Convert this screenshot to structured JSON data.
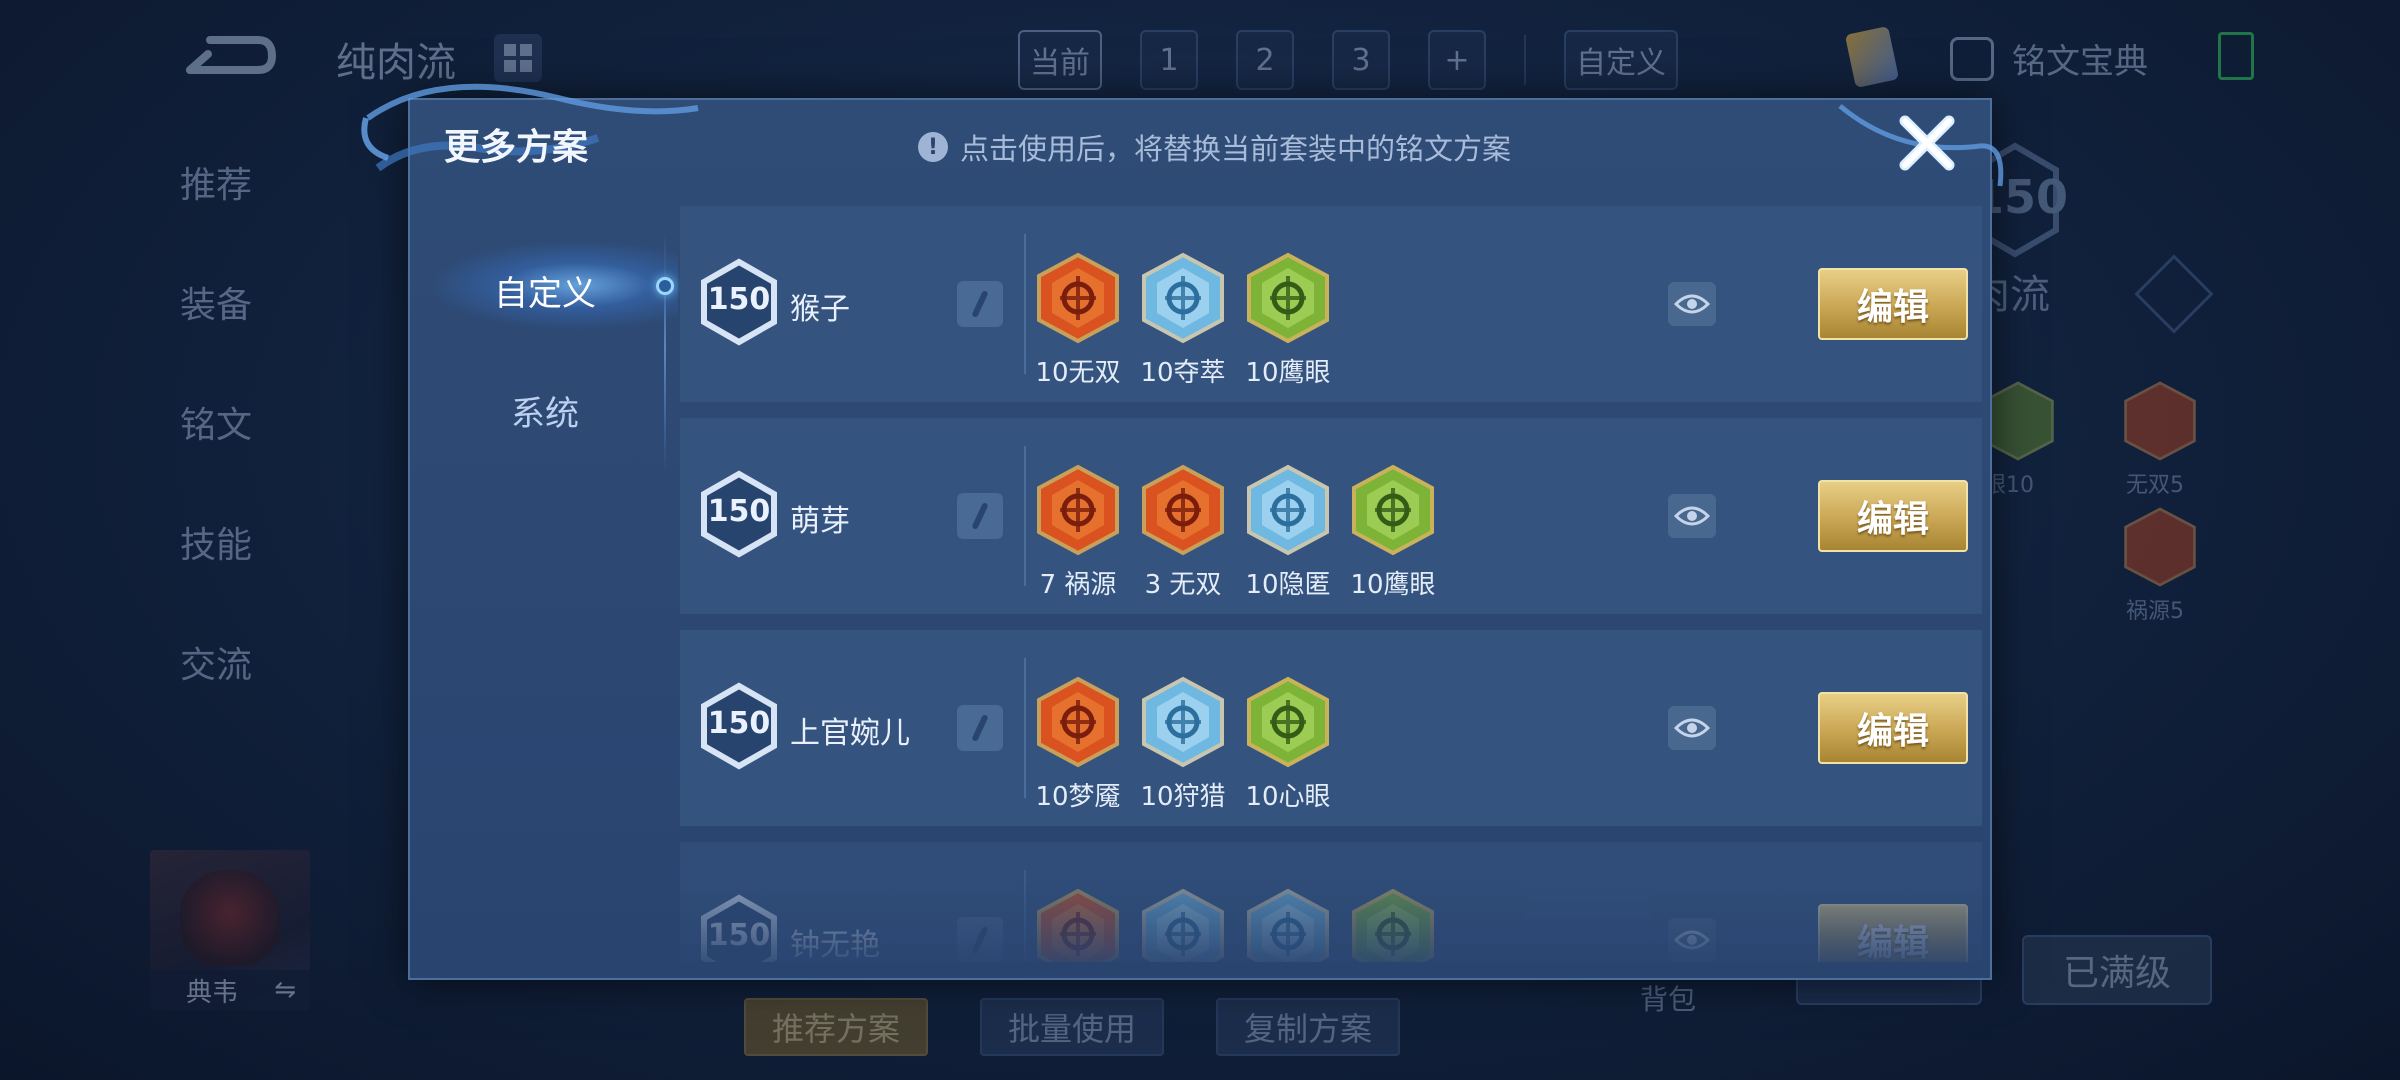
{
  "background": {
    "scheme_name": "纯肉流",
    "top_tabs": [
      "当前",
      "1",
      "2",
      "3",
      "+"
    ],
    "custom_tab": "自定义",
    "codex_label": "铭文宝典",
    "left_nav": [
      "推荐",
      "装备",
      "铭文",
      "技能",
      "交流"
    ],
    "hero_name": "典韦",
    "hero_swap_symbol": "⇋",
    "bottom_buttons": [
      "推荐方案",
      "批量使用",
      "复制方案"
    ],
    "bag_label": "背包",
    "level_badge": "150",
    "rou_label": "肉流",
    "max_level_button": "已满级",
    "gem_labels": [
      "眼10",
      "无双5",
      "祸源5"
    ]
  },
  "modal": {
    "title": "更多方案",
    "notice": "点击使用后，将替换当前套装中的铭文方案",
    "tabs": [
      {
        "label": "自定义",
        "active": true
      },
      {
        "label": "系统",
        "active": false
      }
    ],
    "edit_label": "编辑",
    "rows": [
      {
        "level": "150",
        "name": "猴子",
        "gems": [
          {
            "label": "10无双",
            "icon": "wushuang-rune-icon",
            "color": "red"
          },
          {
            "label": "10夺萃",
            "icon": "duocui-rune-icon",
            "color": "blue"
          },
          {
            "label": "10鹰眼",
            "icon": "yingyan-rune-icon",
            "color": "green"
          }
        ]
      },
      {
        "level": "150",
        "name": "萌芽",
        "gems": [
          {
            "label": "7 祸源",
            "icon": "huoyuan-rune-icon",
            "color": "red"
          },
          {
            "label": "3 无双",
            "icon": "wushuang-rune-icon",
            "color": "red"
          },
          {
            "label": "10隐匿",
            "icon": "yinni-rune-icon",
            "color": "blue"
          },
          {
            "label": "10鹰眼",
            "icon": "yingyan-rune-icon",
            "color": "green"
          }
        ]
      },
      {
        "level": "150",
        "name": "上官婉儿",
        "gems": [
          {
            "label": "10梦魇",
            "icon": "mengyan-rune-icon",
            "color": "red"
          },
          {
            "label": "10狩猎",
            "icon": "shoulie-rune-icon",
            "color": "blue"
          },
          {
            "label": "10心眼",
            "icon": "xinyan-rune-icon",
            "color": "green"
          }
        ]
      },
      {
        "level": "150",
        "name": "钟无艳",
        "gems": [
          {
            "label": "",
            "icon": "red-rune-icon",
            "color": "red"
          },
          {
            "label": "",
            "icon": "blue-rune-icon",
            "color": "blue"
          },
          {
            "label": "",
            "icon": "blue-rune-icon",
            "color": "blue"
          },
          {
            "label": "",
            "icon": "green-rune-icon",
            "color": "green"
          }
        ]
      }
    ]
  },
  "colors": {
    "red_rune": "#e2622a",
    "blue_rune": "#7fc4ea",
    "green_rune": "#8cc043",
    "gold_button": "#c9a654",
    "panel": "#2f4c76"
  }
}
